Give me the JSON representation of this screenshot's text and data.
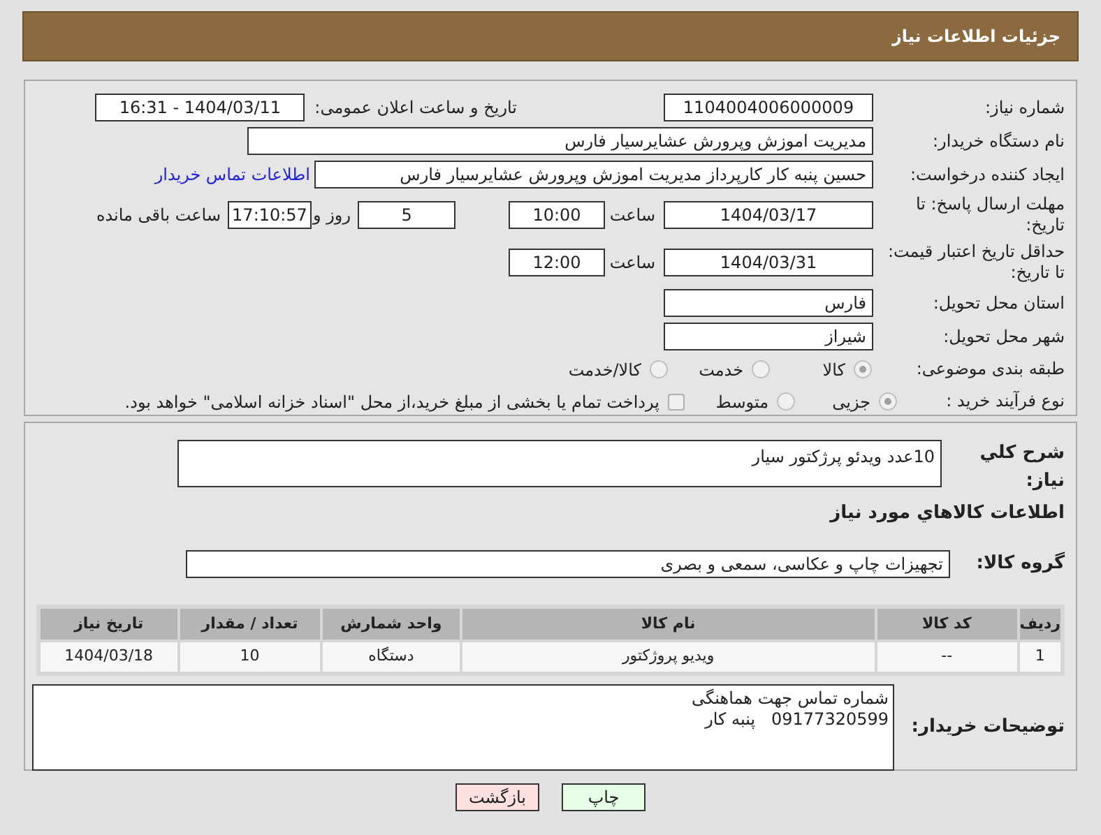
{
  "header": {
    "title": "جزئیات اطلاعات نیاز"
  },
  "need_number": {
    "label": "شماره نیاز:",
    "value": "1104004006000009"
  },
  "announce": {
    "label": "تاریخ و ساعت اعلان عمومی:",
    "value": "1404/03/11 - 16:31"
  },
  "buyer_org": {
    "label": "نام دستگاه خریدار:",
    "value": "مدیریت اموزش وپرورش عشایرسیار فارس"
  },
  "requester": {
    "label": "ایجاد کننده درخواست:",
    "value": "حسین پنبه کار کارپرداز مدیریت اموزش وپرورش عشایرسیار فارس",
    "link": "اطلاعات تماس خریدار"
  },
  "deadline": {
    "label": "مهلت ارسال پاسخ: تا تاریخ:",
    "date": "1404/03/17",
    "time_label": "ساعت",
    "time": "10:00",
    "days": "5",
    "days_label": "روز و",
    "remaining": "17:10:57",
    "remaining_label": "ساعت باقی مانده"
  },
  "validity": {
    "label": "حداقل تاریخ اعتبار قیمت: تا تاریخ:",
    "date": "1404/03/31",
    "time_label": "ساعت",
    "time": "12:00"
  },
  "province": {
    "label": "استان محل تحویل:",
    "value": "فارس"
  },
  "city": {
    "label": "شهر محل تحویل:",
    "value": "شیراز"
  },
  "category": {
    "label": "طبقه بندی موضوعی:",
    "options": [
      {
        "label": "کالا",
        "selected": true
      },
      {
        "label": "خدمت",
        "selected": false
      },
      {
        "label": "کالا/خدمت",
        "selected": false
      }
    ]
  },
  "process": {
    "label": "نوع فرآیند خرید :",
    "options": [
      {
        "label": "جزیی",
        "selected": true
      },
      {
        "label": "متوسط",
        "selected": false
      }
    ],
    "note": {
      "text": "پرداخت تمام یا بخشی از مبلغ خرید،از محل \"اسناد خزانه اسلامی\" خواهد بود.",
      "checked": false
    }
  },
  "description": {
    "label": "شرح کلي نياز:",
    "value": "10عدد ویدئو پرژکتور سیار"
  },
  "goods": {
    "title": "اطلاعات کالاهاي مورد نياز",
    "group_label": "گروه کالا:",
    "group_value": "تجهیزات چاپ و عکاسی، سمعی و بصری"
  },
  "table": {
    "columns": [
      "ردیف",
      "کد کالا",
      "نام کالا",
      "واحد شمارش",
      "تعداد / مقدار",
      "تاریخ نیاز"
    ],
    "rows": [
      [
        "1",
        "--",
        "ویدیو پروژکتور",
        "دستگاه",
        "10",
        "1404/03/18"
      ]
    ]
  },
  "buyer_notes": {
    "label": "توضیحات خریدار:",
    "lines": [
      "شماره تماس جهت هماهنگی",
      "09177320599   پنبه کار"
    ]
  },
  "buttons": [
    {
      "label": "چاپ",
      "kind": "print"
    },
    {
      "label": "بازگشت",
      "kind": "back"
    }
  ]
}
